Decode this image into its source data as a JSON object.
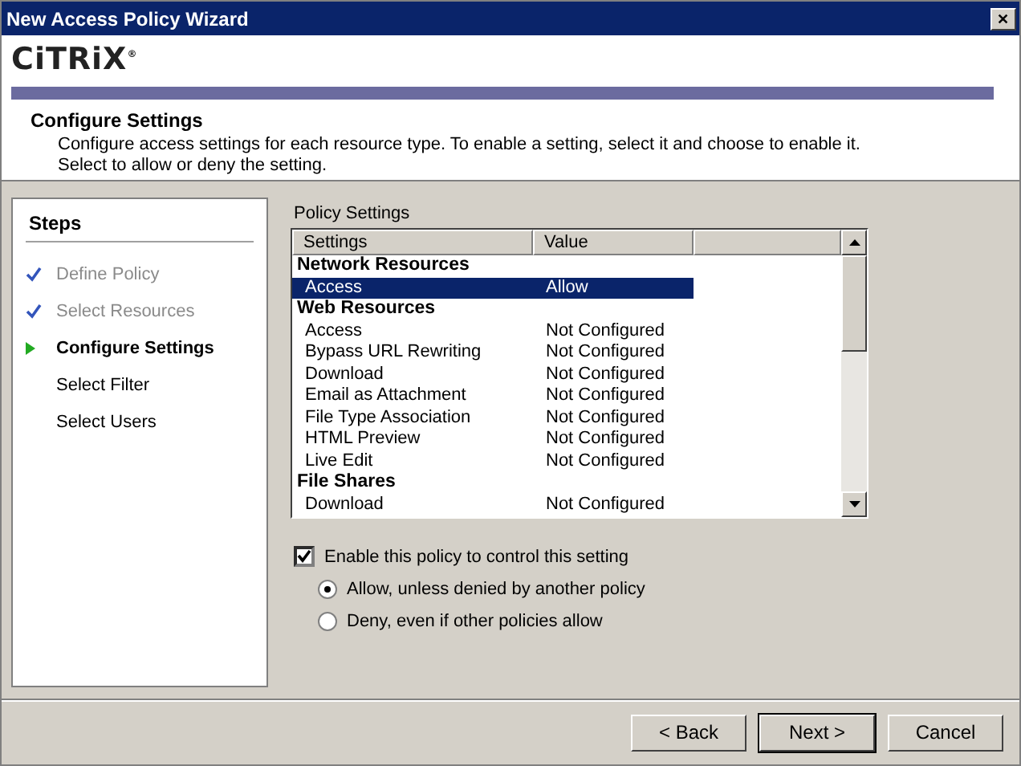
{
  "window": {
    "title": "New Access Policy Wizard",
    "close": "✕"
  },
  "header": {
    "logo": "CiTRiX",
    "logo_mark": "®",
    "title": "Configure Settings",
    "description": "Configure access settings for each resource type. To enable a setting, select it and choose to enable it.\nSelect to allow or deny the setting."
  },
  "steps": {
    "title": "Steps",
    "items": [
      {
        "label": "Define Policy",
        "kind": "done"
      },
      {
        "label": "Select Resources",
        "kind": "done"
      },
      {
        "label": "Configure Settings",
        "kind": "current"
      },
      {
        "label": "Select Filter",
        "kind": "pending"
      },
      {
        "label": "Select Users",
        "kind": "pending"
      }
    ]
  },
  "policy_settings": {
    "label": "Policy Settings",
    "columns": [
      "Settings",
      "Value"
    ],
    "groups": [
      {
        "name": "Network Resources",
        "children": [
          {
            "label": "Access",
            "value": "Allow",
            "selected": true
          }
        ]
      },
      {
        "name": "Web Resources",
        "children": [
          {
            "label": "Access",
            "value": "Not Configured",
            "selected": false
          },
          {
            "label": "Bypass URL Rewriting",
            "value": "Not Configured",
            "selected": false
          },
          {
            "label": "Download",
            "value": "Not Configured",
            "selected": false
          },
          {
            "label": "Email as Attachment",
            "value": "Not Configured",
            "selected": false
          },
          {
            "label": "File Type Association",
            "value": "Not Configured",
            "selected": false
          },
          {
            "label": "HTML Preview",
            "value": "Not Configured",
            "selected": false
          },
          {
            "label": "Live Edit",
            "value": "Not Configured",
            "selected": false
          }
        ]
      },
      {
        "name": "File Shares",
        "children": [
          {
            "label": "Download",
            "value": "Not Configured",
            "selected": false
          }
        ]
      }
    ]
  },
  "enable": {
    "label": "Enable this policy to control this setting",
    "checked": true
  },
  "options": [
    {
      "label": "Allow, unless denied by another policy",
      "selected": true
    },
    {
      "label": "Deny, even if other policies allow",
      "selected": false
    }
  ],
  "buttons": [
    {
      "label": "< Back",
      "default": false
    },
    {
      "label": "Next >",
      "default": true
    },
    {
      "label": "Cancel",
      "default": false
    }
  ]
}
